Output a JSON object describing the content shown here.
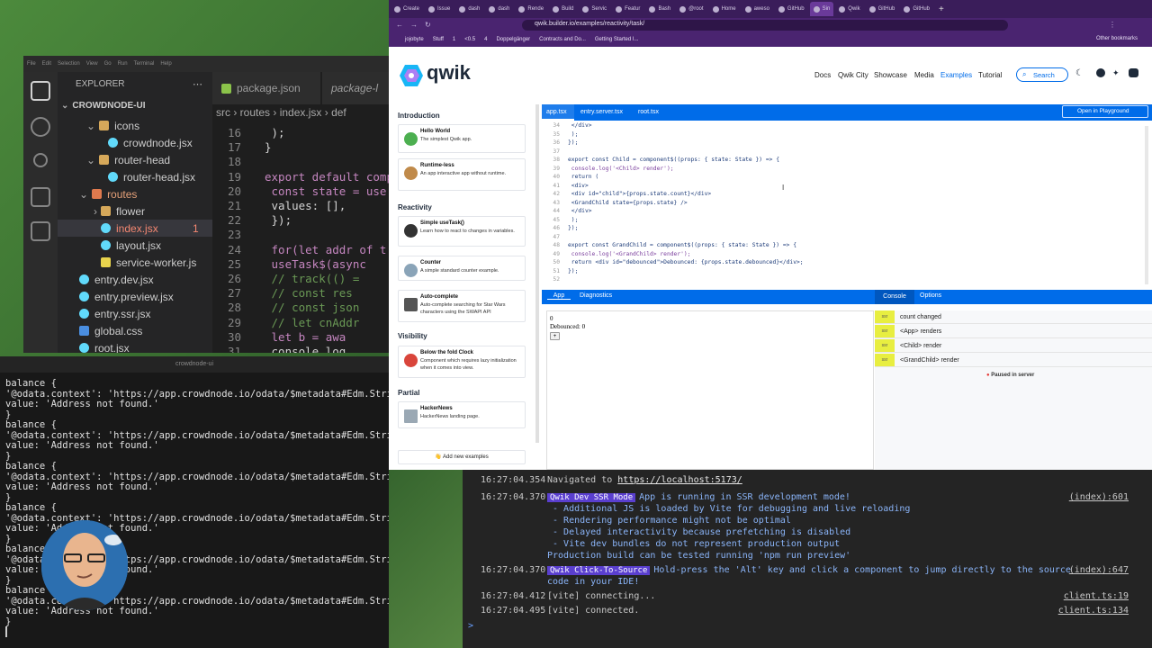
{
  "colors": {
    "accent": "#006ce9",
    "qwik_purple": "#ac7ef4",
    "vscode_bg": "#1e1e1e",
    "browser_chrome": "#3a1d5a"
  },
  "vscode": {
    "menu": [
      "File",
      "Edit",
      "Selection",
      "View",
      "Go",
      "Run",
      "Terminal",
      "Help"
    ],
    "explorer_title": "EXPLORER",
    "project": "CROWDNODE-UI",
    "tree": [
      {
        "label": "icons",
        "kind": "folder"
      },
      {
        "label": "crowdnode.jsx",
        "kind": "file"
      },
      {
        "label": "router-head",
        "kind": "folder"
      },
      {
        "label": "router-head.jsx",
        "kind": "file"
      },
      {
        "label": "routes",
        "kind": "folder"
      },
      {
        "label": "flower",
        "kind": "folder"
      },
      {
        "label": "index.jsx",
        "kind": "file",
        "badge": "1"
      },
      {
        "label": "layout.jsx",
        "kind": "file"
      },
      {
        "label": "service-worker.js",
        "kind": "file"
      },
      {
        "label": "entry.dev.jsx",
        "kind": "file"
      },
      {
        "label": "entry.preview.jsx",
        "kind": "file"
      },
      {
        "label": "entry.ssr.jsx",
        "kind": "file"
      },
      {
        "label": "global.css",
        "kind": "file"
      },
      {
        "label": "root.jsx",
        "kind": "file"
      }
    ],
    "tabs": [
      "package.json",
      "package-l"
    ],
    "breadcrumb": [
      "src",
      "routes",
      "index.jsx",
      "def"
    ],
    "code": [
      {
        "n": "16",
        "t": "  );"
      },
      {
        "n": "17",
        "t": "}"
      },
      {
        "n": "18",
        "t": ""
      },
      {
        "n": "19",
        "t": "export default comp"
      },
      {
        "n": "20",
        "t": "  const state = use"
      },
      {
        "n": "21",
        "t": "    values: [],"
      },
      {
        "n": "22",
        "t": "  });"
      },
      {
        "n": "23",
        "t": ""
      },
      {
        "n": "24",
        "t": "  for(let addr of t"
      },
      {
        "n": "25",
        "t": "    useTask$(async"
      },
      {
        "n": "26",
        "t": "      // track(() ="
      },
      {
        "n": "27",
        "t": "      // const res"
      },
      {
        "n": "28",
        "t": "      // const json"
      },
      {
        "n": "29",
        "t": "      // let cnAddr"
      },
      {
        "n": "30",
        "t": "        let b = awa"
      },
      {
        "n": "31",
        "t": "        console.log"
      }
    ]
  },
  "terminal": {
    "title": "crowdnode-ui",
    "lines": [
      "balance {",
      "  '@odata.context': 'https://app.crowdnode.io/odata/$metadata#Edm.String',",
      "  value: 'Address not found.'",
      "}",
      "balance {",
      "  '@odata.context': 'https://app.crowdnode.io/odata/$metadata#Edm.String',",
      "  value: 'Address not found.'",
      "}",
      "balance {",
      "  '@odata.context': 'https://app.crowdnode.io/odata/$metadata#Edm.String',",
      "  value: 'Address not found.'",
      "}",
      "balance {",
      "  '@odata.context': 'https://app.crowdnode.io/odata/$metadata#Edm.String',",
      "  value: 'Address not found.'",
      "}",
      "balance {",
      "  '@odata.context': 'https://app.crowdnode.io/odata/$metadata#Edm.String',",
      "  value: 'Address not found.'",
      "}",
      "balance {",
      "  '@odata.context': 'https://app.crowdnode.io/odata/$metadata#Edm.String',",
      "  value: 'Address not found.'",
      "}"
    ]
  },
  "browser": {
    "tabs": [
      "Create",
      "Issue",
      "dash",
      "dash",
      "Rende",
      "Build",
      "Servic",
      "Featur",
      "Bash",
      "@root",
      "Home",
      "aweso",
      "GitHub",
      "Sin",
      "Qwik",
      "GitHub",
      "GitHub"
    ],
    "url": "qwik.builder.io/examples/reactivity/task/",
    "bookmarks": [
      "jojobyte",
      "Stuff",
      "1",
      "<0.5",
      "4",
      "Doppelgänger",
      "Contracts and Do...",
      "Getting Started I..."
    ],
    "other_bookmarks": "Other bookmarks"
  },
  "qwik": {
    "logo_text": "qwik",
    "nav": [
      "Docs",
      "Qwik City",
      "Showcase",
      "Media",
      "Examples",
      "Tutorial"
    ],
    "search": "Search",
    "sections": [
      {
        "title": "Introduction",
        "items": [
          {
            "name": "Hello World",
            "desc": "The simplest Qwik app."
          },
          {
            "name": "Runtime-less",
            "desc": "An app interactive app without runtime."
          }
        ]
      },
      {
        "title": "Reactivity",
        "items": [
          {
            "name": "Simple useTask()",
            "desc": "Learn how to react to changes in variables."
          },
          {
            "name": "Counter",
            "desc": "A simple standard counter example."
          },
          {
            "name": "Auto-complete",
            "desc": "Auto-complete searching for Star Wars characters using the SWAPI API"
          }
        ]
      },
      {
        "title": "Visibility",
        "items": [
          {
            "name": "Below the fold Clock",
            "desc": "Component which requires lazy initialization when it comes into view."
          }
        ]
      },
      {
        "title": "Partial",
        "items": [
          {
            "name": "HackerNews",
            "desc": "HackerNews landing page."
          }
        ]
      }
    ],
    "add_examples": "Add new examples",
    "code_tabs": [
      "app.tsx",
      "entry.server.tsx",
      "root.tsx"
    ],
    "open_playground": "Open in Playground",
    "code": [
      {
        "n": "34",
        "t": "      </div>"
      },
      {
        "n": "35",
        "t": "    );"
      },
      {
        "n": "36",
        "t": "});"
      },
      {
        "n": "37",
        "t": ""
      },
      {
        "n": "38",
        "t": "export const Child = component$((props: { state: State }) => {"
      },
      {
        "n": "39",
        "t": "  console.log('<Child> render');"
      },
      {
        "n": "40",
        "t": "  return ("
      },
      {
        "n": "41",
        "t": "    <div>"
      },
      {
        "n": "42",
        "t": "      <div id=\"child\">{props.state.count}</div>"
      },
      {
        "n": "43",
        "t": "      <GrandChild state={props.state} />"
      },
      {
        "n": "44",
        "t": "    </div>"
      },
      {
        "n": "45",
        "t": "  );"
      },
      {
        "n": "46",
        "t": "});"
      },
      {
        "n": "47",
        "t": ""
      },
      {
        "n": "48",
        "t": "export const GrandChild = component$((props: { state: State }) => {"
      },
      {
        "n": "49",
        "t": "  console.log('<GrandChild> render');"
      },
      {
        "n": "50",
        "t": "  return <div id=\"debounced\">Debounced: {props.state.debounced}</div>;"
      },
      {
        "n": "51",
        "t": "});"
      },
      {
        "n": "52",
        "t": ""
      }
    ],
    "app_tabs": [
      "App",
      "Diagnostics"
    ],
    "console_tabs": [
      "Console",
      "Options"
    ],
    "app_output": {
      "count": "0",
      "debounced": "Debounced: 0",
      "button": "+"
    },
    "console_logs": [
      "count changed",
      "<App> renders",
      "<Child> render",
      "<GrandChild> render"
    ],
    "log_badge": "ssr",
    "paused": "Paused in server"
  },
  "devtools": {
    "lines": [
      {
        "time": "16:27:04.354",
        "badge": "",
        "text": "Navigated to ",
        "link": "https://localhost:5173/",
        "src": ""
      },
      {
        "time": "16:27:04.370",
        "badge": "Qwik Dev SSR Mode",
        "text": "App is running in SSR development mode!",
        "src": "(index):601"
      },
      {
        "time": "",
        "badge": "",
        "text": " - Additional JS is loaded by Vite for debugging and live reloading",
        "src": ""
      },
      {
        "time": "",
        "badge": "",
        "text": " - Rendering performance might not be optimal",
        "src": ""
      },
      {
        "time": "",
        "badge": "",
        "text": " - Delayed interactivity because prefetching is disabled",
        "src": ""
      },
      {
        "time": "",
        "badge": "",
        "text": " - Vite dev bundles do not represent production output",
        "src": ""
      },
      {
        "time": "",
        "badge": "",
        "text": "Production build can be tested running 'npm run preview'",
        "src": ""
      },
      {
        "time": "16:27:04.370",
        "badge": "Qwik Click-To-Source",
        "text": "Hold-press the 'Alt' key and click a component to jump directly to the source",
        "src": "(index):647"
      },
      {
        "time": "",
        "badge": "",
        "text": "code in your IDE!",
        "src": ""
      },
      {
        "time": "16:27:04.412",
        "badge": "",
        "text": "[vite] connecting...",
        "src": "client.ts:19"
      },
      {
        "time": "16:27:04.495",
        "badge": "",
        "text": "[vite] connected.",
        "src": "client.ts:134"
      }
    ],
    "prompt": ">"
  }
}
